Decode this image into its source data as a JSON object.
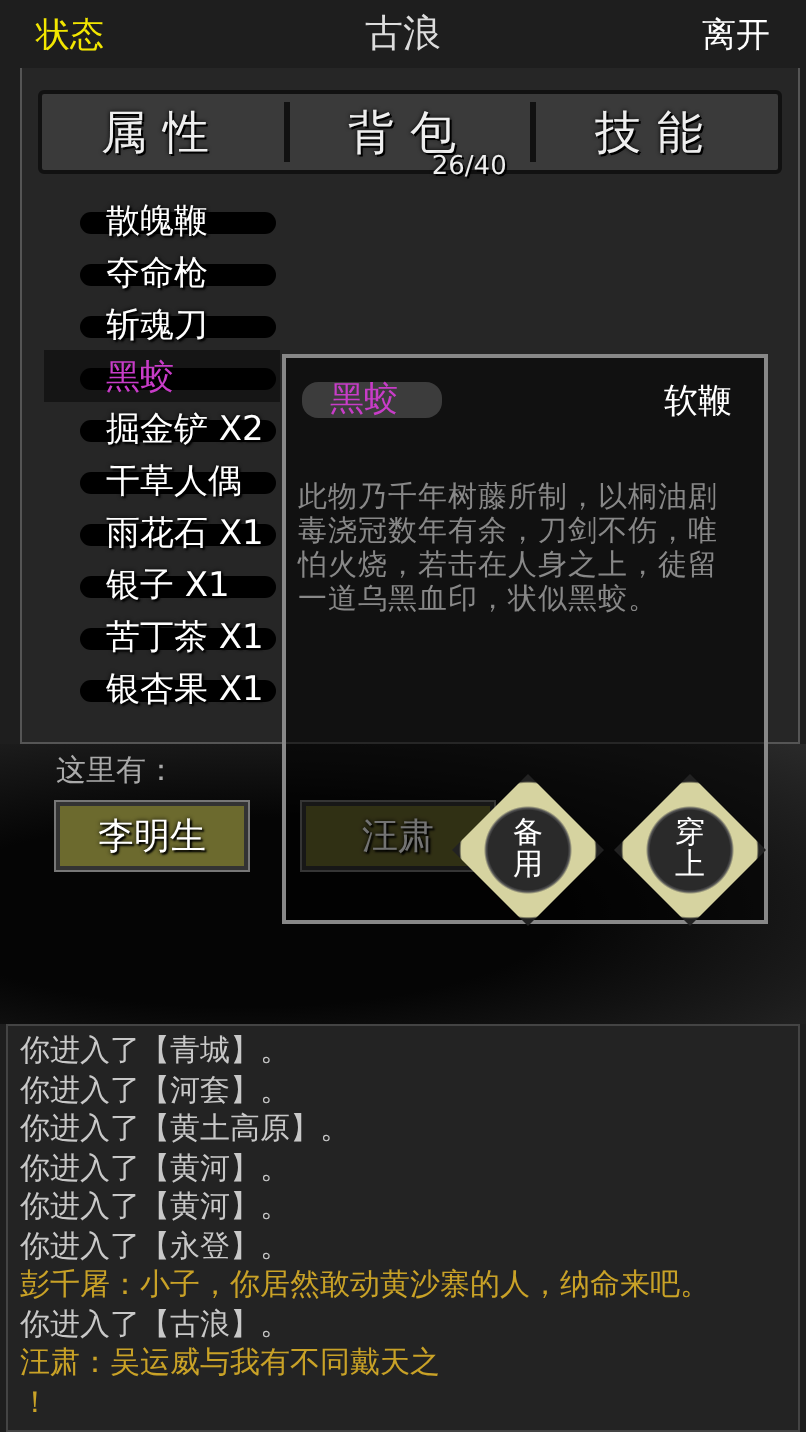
{
  "header": {
    "left": "状态",
    "title": "古浪",
    "right": "离开"
  },
  "tabs": [
    {
      "label": "属性"
    },
    {
      "label": "背包",
      "count": "26/40"
    },
    {
      "label": "技能"
    }
  ],
  "inventory": [
    {
      "name": "散魄鞭",
      "selected": false
    },
    {
      "name": "夺命枪",
      "selected": false
    },
    {
      "name": "斩魂刀",
      "selected": false
    },
    {
      "name": "黑蛟",
      "selected": true
    },
    {
      "name": "掘金铲 X2",
      "selected": false
    },
    {
      "name": "干草人偶",
      "selected": false
    },
    {
      "name": "雨花石 X1",
      "selected": false
    },
    {
      "name": "银子 X1",
      "selected": false
    },
    {
      "name": "苦丁茶 X1",
      "selected": false
    },
    {
      "name": "银杏果 X1",
      "selected": false
    }
  ],
  "item_detail": {
    "name": "黑蛟",
    "type": "软鞭",
    "description": "此物乃千年树藤所制，以桐油剧毒浇冠数年有余，刀剑不伤，唯怕火烧，若击在人身之上，徒留一道乌黑血印，状似黑蛟。",
    "actions": [
      "备用",
      "穿上"
    ]
  },
  "nearby": {
    "label": "这里有：",
    "npcs": [
      "李明生",
      "汪肃"
    ]
  },
  "log": [
    {
      "kind": "system",
      "text": "你进入了【青城】。"
    },
    {
      "kind": "system",
      "text": "你进入了【河套】。"
    },
    {
      "kind": "system",
      "text": "你进入了【黄土高原】。"
    },
    {
      "kind": "system",
      "text": "你进入了【黄河】。"
    },
    {
      "kind": "system",
      "text": "你进入了【黄河】。"
    },
    {
      "kind": "system",
      "text": "你进入了【永登】。"
    },
    {
      "kind": "dialog",
      "text": "彭千屠：小子，你居然敢动黄沙寨的人，纳命来吧。"
    },
    {
      "kind": "system",
      "text": "你进入了【古浪】。"
    },
    {
      "kind": "dialog",
      "text": "汪肃：吴运威与我有不同戴天之"
    },
    {
      "kind": "dialog",
      "text": "！"
    }
  ]
}
